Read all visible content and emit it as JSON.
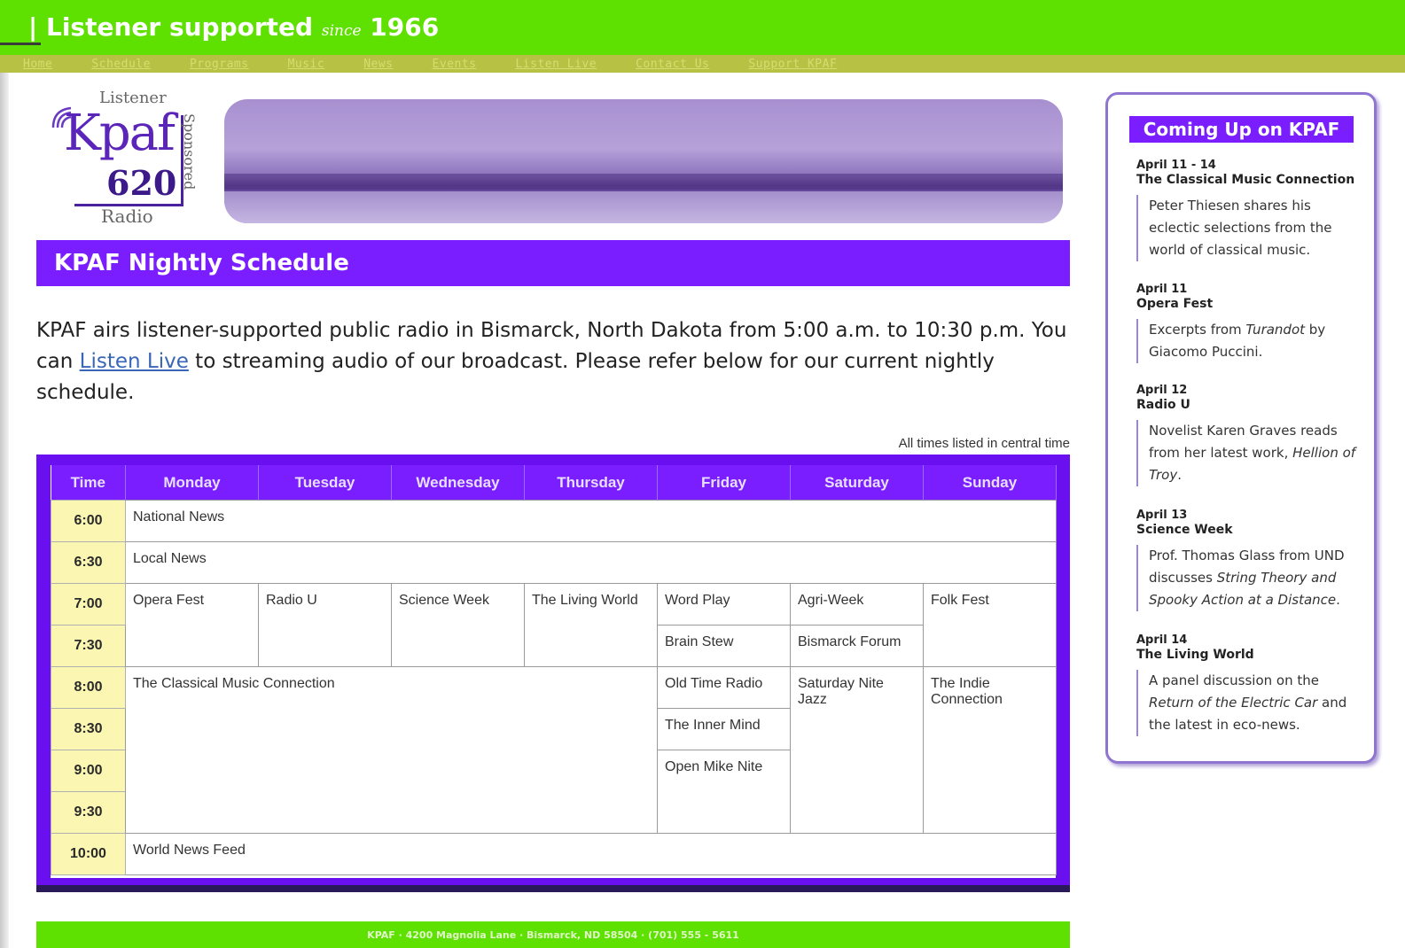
{
  "header": {
    "tagline_main": "Listener supported",
    "tagline_since": "since",
    "tagline_year": "1966",
    "pipe": "|"
  },
  "nav": [
    "Home",
    "Schedule",
    "Programs",
    "Music",
    "News",
    "Events",
    "Listen Live",
    "Contact Us",
    "Support KPAF"
  ],
  "logo": {
    "listener": "Listener",
    "name": "Kpaf",
    "freq": "620",
    "radio": "Radio",
    "sponsored": "Sponsored"
  },
  "page_title": "KPAF Nightly Schedule",
  "intro": {
    "before_link": "KPAF airs listener-supported public radio in Bismarck, North Dakota from 5:00 a.m. to 10:30 p.m. You can ",
    "link": "Listen Live",
    "after_link": " to streaming audio of our broadcast. Please refer below for our current nightly schedule."
  },
  "tz_note": "All times listed in central time",
  "schedule": {
    "headers": [
      "Time",
      "Monday",
      "Tuesday",
      "Wednesday",
      "Thursday",
      "Friday",
      "Saturday",
      "Sunday"
    ],
    "times": [
      "6:00",
      "6:30",
      "7:00",
      "7:30",
      "8:00",
      "8:30",
      "9:00",
      "9:30",
      "10:00"
    ],
    "national_news": "National News",
    "local_news": "Local News",
    "opera_fest": "Opera Fest",
    "radio_u": "Radio U",
    "science_week": "Science Week",
    "living_world": "The Living World",
    "word_play": "Word Play",
    "agri_week": "Agri-Week",
    "folk_fest": "Folk Fest",
    "brain_stew": "Brain Stew",
    "bismarck_forum": "Bismarck Forum",
    "classical": "The Classical Music Connection",
    "old_time_radio": "Old Time Radio",
    "saturday_nite_jazz": "Saturday Nite Jazz",
    "indie_connection": "The Indie Connection",
    "inner_mind": "The Inner Mind",
    "open_mike": "Open Mike Nite",
    "world_news_feed": "World News Feed"
  },
  "sidebar": {
    "title": "Coming Up on KPAF",
    "events": [
      {
        "date": "April 11 - 14",
        "name": "The Classical Music Connection",
        "desc": "Peter Thiesen shares his eclectic selections from the world of classical music."
      },
      {
        "date": "April 11",
        "name": "Opera Fest",
        "desc_a": "Excerpts from ",
        "desc_i": "Turandot",
        "desc_b": " by Giacomo Puccini."
      },
      {
        "date": "April 12",
        "name": "Radio U",
        "desc_a": "Novelist Karen Graves reads from her latest work, ",
        "desc_i": "Hellion of Troy",
        "desc_b": "."
      },
      {
        "date": "April 13",
        "name": "Science Week",
        "desc_a": "Prof. Thomas Glass from UND discusses ",
        "desc_i": "String Theory and Spooky Action at a Distance",
        "desc_b": "."
      },
      {
        "date": "April 14",
        "name": "The Living World",
        "desc_a": "A panel discussion on the ",
        "desc_i": "Return of the Electric Car",
        "desc_b": " and the latest in eco-news."
      }
    ]
  },
  "footer": "KPAF · 4200 Magnolia Lane · Bismarck, ND 58504 · (701) 555 - 5611"
}
